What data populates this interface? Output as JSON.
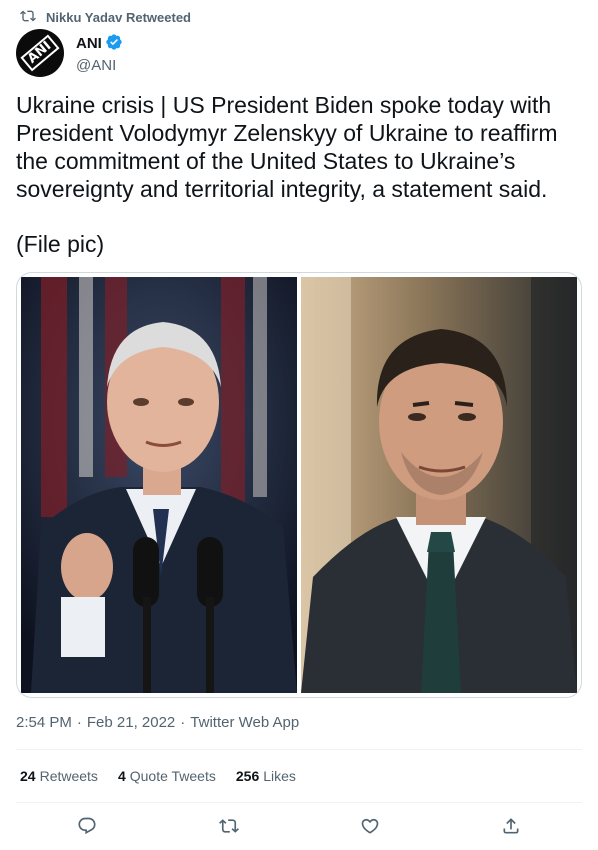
{
  "social_context": {
    "retweeted_by": "Nikku Yadav Retweeted"
  },
  "author": {
    "name": "ANI",
    "handle": "@ANI",
    "avatar_text": "ANI",
    "verified": true
  },
  "tweet": {
    "text": "Ukraine crisis | US President Biden spoke today with\nPresident Volodymyr Zelenskyy of Ukraine to reaffirm\nthe commitment of the United States to Ukraine’s\nsovereignty and territorial integrity, a statement said.",
    "file_pic": "(File pic)"
  },
  "meta": {
    "time": "2:54 PM",
    "date": "Feb 21, 2022",
    "source": "Twitter Web App",
    "sep": "·"
  },
  "stats": {
    "retweets_count": "24",
    "retweets_label": "Retweets",
    "quote_count": "4",
    "quote_label": "Quote Tweets",
    "likes_count": "256",
    "likes_label": "Likes"
  },
  "colors": {
    "text": "#0f1419",
    "secondary": "#536471",
    "verified_blue": "#1d9bf0",
    "divider": "#eff3f4"
  },
  "icons": [
    "retweet-icon",
    "verified-badge-icon",
    "reply-icon",
    "retweet-icon",
    "like-icon",
    "share-icon"
  ]
}
